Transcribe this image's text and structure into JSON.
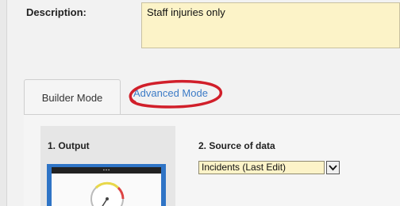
{
  "description": {
    "label": "Description:",
    "value": "Staff injuries only"
  },
  "tabs": [
    {
      "label": "Builder Mode",
      "active": true
    },
    {
      "label": "Advanced Mode",
      "active": false,
      "annotated": true
    }
  ],
  "annotation_color": "#d11f2a",
  "sections": {
    "output": {
      "title": "1. Output"
    },
    "source": {
      "title": "2. Source of data",
      "selected": "Incidents (Last Edit)"
    }
  },
  "icons": {
    "dropdown": "chevron-down-icon",
    "preview": "gauge-chart-preview"
  }
}
